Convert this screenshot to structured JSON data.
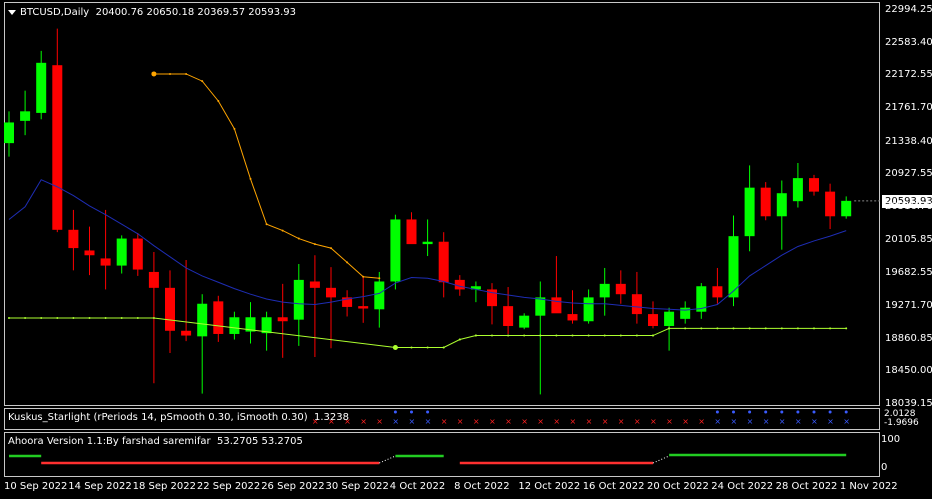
{
  "header": {
    "symbol": "BTCUSD,Daily",
    "ohlc": "20400.76 20650.18 20369.57 20593.93"
  },
  "indicators": {
    "kuskus_label": "Kuskus_Starlight (rPeriods 14, pSmooth 0.30, iSmooth 0.30)",
    "kuskus_value": "1.3238",
    "kuskus_axis_top": "2.0128",
    "kuskus_axis_bottom": "-1.9696",
    "ahoora_label": "Ahoora Version 1.1:By farshad saremifar",
    "ahoora_values": "53.2705 53.2705",
    "ahoora_axis_top": "100",
    "ahoora_axis_bottom": "0"
  },
  "price_badge": "20593.93",
  "colors": {
    "background": "#000000",
    "bull": "#00ff00",
    "bear": "#ff0000",
    "ma": "#1e2db4",
    "orange_line": "#ffa500",
    "green_line": "#adff2f",
    "grid_text": "#ffffff"
  },
  "chart_data": [
    {
      "type": "candlestick",
      "ylabels": [
        "22994.25",
        "22583.40",
        "22172.55",
        "21761.70",
        "21338.40",
        "20927.55",
        "20516.70",
        "20105.85",
        "19682.55",
        "19271.70",
        "18860.85",
        "18450.00",
        "18039.15"
      ],
      "xlabels": [
        "10 Sep 2022",
        "14 Sep 2022",
        "18 Sep 2022",
        "22 Sep 2022",
        "26 Sep 2022",
        "30 Sep 2022",
        "4 Oct 2022",
        "8 Oct 2022",
        "12 Oct 2022",
        "16 Oct 2022",
        "20 Oct 2022",
        "24 Oct 2022",
        "28 Oct 2022",
        "1 Nov 2022"
      ],
      "ylim": [
        18039.15,
        22994.25
      ],
      "candles": [
        {
          "o": 21320,
          "h": 21720,
          "l": 21150,
          "c": 21580
        },
        {
          "o": 21600,
          "h": 21980,
          "l": 21420,
          "c": 21720
        },
        {
          "o": 21700,
          "h": 22480,
          "l": 21620,
          "c": 22330
        },
        {
          "o": 22300,
          "h": 22760,
          "l": 20200,
          "c": 20230
        },
        {
          "o": 20230,
          "h": 20480,
          "l": 19720,
          "c": 20000
        },
        {
          "o": 19970,
          "h": 20270,
          "l": 19660,
          "c": 19910
        },
        {
          "o": 19870,
          "h": 20480,
          "l": 19480,
          "c": 19780
        },
        {
          "o": 19780,
          "h": 20160,
          "l": 19680,
          "c": 20120
        },
        {
          "o": 20120,
          "h": 20190,
          "l": 19650,
          "c": 19730
        },
        {
          "o": 19700,
          "h": 19950,
          "l": 18300,
          "c": 19500
        },
        {
          "o": 19500,
          "h": 19720,
          "l": 18680,
          "c": 18960
        },
        {
          "o": 18960,
          "h": 19850,
          "l": 18830,
          "c": 18900
        },
        {
          "o": 18890,
          "h": 19420,
          "l": 18170,
          "c": 19300
        },
        {
          "o": 19330,
          "h": 19400,
          "l": 18820,
          "c": 18920
        },
        {
          "o": 18920,
          "h": 19200,
          "l": 18850,
          "c": 19130
        },
        {
          "o": 18950,
          "h": 19320,
          "l": 18800,
          "c": 19130
        },
        {
          "o": 18930,
          "h": 19200,
          "l": 18710,
          "c": 19130
        },
        {
          "o": 19130,
          "h": 19550,
          "l": 18620,
          "c": 19080
        },
        {
          "o": 19100,
          "h": 19800,
          "l": 18770,
          "c": 19600
        },
        {
          "o": 19580,
          "h": 19910,
          "l": 18630,
          "c": 19500
        },
        {
          "o": 19500,
          "h": 19760,
          "l": 18740,
          "c": 19380
        },
        {
          "o": 19380,
          "h": 19470,
          "l": 19140,
          "c": 19260
        },
        {
          "o": 19270,
          "h": 19630,
          "l": 19060,
          "c": 19240
        },
        {
          "o": 19230,
          "h": 19700,
          "l": 19000,
          "c": 19580
        },
        {
          "o": 19580,
          "h": 20420,
          "l": 19480,
          "c": 20360
        },
        {
          "o": 20360,
          "h": 20450,
          "l": 20080,
          "c": 20050
        },
        {
          "o": 20050,
          "h": 20360,
          "l": 19900,
          "c": 20080
        },
        {
          "o": 20080,
          "h": 20200,
          "l": 19380,
          "c": 19570
        },
        {
          "o": 19600,
          "h": 19660,
          "l": 19400,
          "c": 19480
        },
        {
          "o": 19480,
          "h": 19580,
          "l": 19320,
          "c": 19520
        },
        {
          "o": 19480,
          "h": 19560,
          "l": 19040,
          "c": 19270
        },
        {
          "o": 19270,
          "h": 19510,
          "l": 18920,
          "c": 19020
        },
        {
          "o": 19000,
          "h": 19180,
          "l": 18980,
          "c": 19150
        },
        {
          "o": 19150,
          "h": 19580,
          "l": 18160,
          "c": 19380
        },
        {
          "o": 19380,
          "h": 19900,
          "l": 19200,
          "c": 19180
        },
        {
          "o": 19170,
          "h": 19470,
          "l": 19050,
          "c": 19090
        },
        {
          "o": 19080,
          "h": 19480,
          "l": 19050,
          "c": 19380
        },
        {
          "o": 19380,
          "h": 19750,
          "l": 19150,
          "c": 19550
        },
        {
          "o": 19550,
          "h": 19720,
          "l": 19300,
          "c": 19420
        },
        {
          "o": 19420,
          "h": 19700,
          "l": 19050,
          "c": 19170
        },
        {
          "o": 19170,
          "h": 19330,
          "l": 18990,
          "c": 19020
        },
        {
          "o": 19020,
          "h": 19250,
          "l": 18710,
          "c": 19200
        },
        {
          "o": 19110,
          "h": 19330,
          "l": 19050,
          "c": 19250
        },
        {
          "o": 19200,
          "h": 19560,
          "l": 19110,
          "c": 19520
        },
        {
          "o": 19520,
          "h": 19750,
          "l": 19300,
          "c": 19380
        },
        {
          "o": 19380,
          "h": 20410,
          "l": 19270,
          "c": 20150
        },
        {
          "o": 20150,
          "h": 21040,
          "l": 19960,
          "c": 20760
        },
        {
          "o": 20760,
          "h": 20830,
          "l": 20350,
          "c": 20400
        },
        {
          "o": 20400,
          "h": 20850,
          "l": 19980,
          "c": 20690
        },
        {
          "o": 20590,
          "h": 21070,
          "l": 20510,
          "c": 20880
        },
        {
          "o": 20880,
          "h": 20920,
          "l": 20660,
          "c": 20710
        },
        {
          "o": 20710,
          "h": 20810,
          "l": 20240,
          "c": 20400
        },
        {
          "o": 20400,
          "h": 20650,
          "l": 20370,
          "c": 20594
        }
      ],
      "moving_average": [
        20360,
        20520,
        20860,
        20770,
        20660,
        20530,
        20420,
        20300,
        20180,
        20030,
        19890,
        19750,
        19650,
        19570,
        19490,
        19420,
        19360,
        19320,
        19300,
        19290,
        19320,
        19360,
        19390,
        19430,
        19560,
        19630,
        19620,
        19580,
        19520,
        19480,
        19440,
        19410,
        19380,
        19360,
        19330,
        19310,
        19300,
        19300,
        19280,
        19260,
        19240,
        19230,
        19220,
        19240,
        19290,
        19460,
        19650,
        19780,
        19910,
        20020,
        20090,
        20150,
        20220
      ],
      "orange_line": [
        {
          "i": 9,
          "v": 22190
        },
        {
          "i": 10,
          "v": 22190
        },
        {
          "i": 11,
          "v": 22190
        },
        {
          "i": 12,
          "v": 22100
        },
        {
          "i": 13,
          "v": 21850
        },
        {
          "i": 14,
          "v": 21500
        },
        {
          "i": 15,
          "v": 20870
        },
        {
          "i": 16,
          "v": 20300
        },
        {
          "i": 17,
          "v": 20220
        },
        {
          "i": 18,
          "v": 20120
        },
        {
          "i": 19,
          "v": 20050
        },
        {
          "i": 20,
          "v": 20000
        },
        {
          "i": 21,
          "v": 19820
        },
        {
          "i": 22,
          "v": 19640
        },
        {
          "i": 23,
          "v": 19620
        }
      ],
      "green_line": [
        {
          "i": 0,
          "v": 19120
        },
        {
          "i": 9,
          "v": 19120
        },
        {
          "i": 24,
          "v": 18750
        },
        {
          "i": 27,
          "v": 18750
        },
        {
          "i": 28,
          "v": 18850
        },
        {
          "i": 29,
          "v": 18900
        },
        {
          "i": 40,
          "v": 18900
        },
        {
          "i": 41,
          "v": 18990
        },
        {
          "i": 52,
          "v": 18990
        }
      ]
    }
  ]
}
